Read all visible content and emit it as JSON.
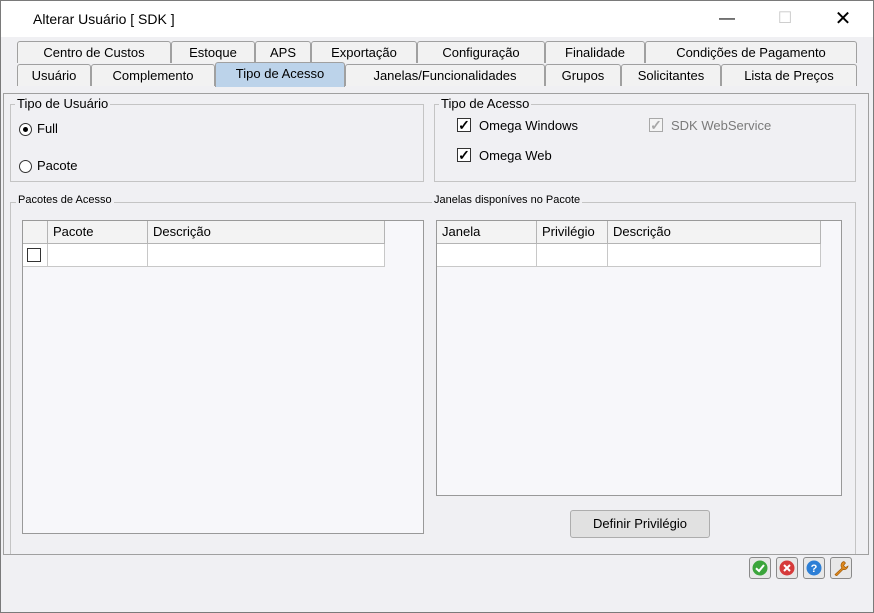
{
  "window": {
    "title": "Alterar Usuário [ SDK ]"
  },
  "tabs_row1": [
    "Centro de Custos",
    "Estoque",
    "APS",
    "Exportação",
    "Configuração",
    "Finalidade",
    "Condições de Pagamento"
  ],
  "tabs_row2": [
    "Usuário",
    "Complemento",
    "Tipo de Acesso",
    "Janelas/Funcionalidades",
    "Grupos",
    "Solicitantes",
    "Lista de Preços"
  ],
  "active_tab": "Tipo de Acesso",
  "tipo_usuario": {
    "title": "Tipo de Usuário",
    "options": [
      "Full",
      "Pacote"
    ],
    "selected": "Full"
  },
  "tipo_acesso": {
    "title": "Tipo de Acesso",
    "omega_windows": "Omega Windows",
    "omega_web": "Omega Web",
    "sdk_webservice": "SDK WebService"
  },
  "pacotes": {
    "title": "Pacotes de Acesso",
    "columns": [
      "",
      "Pacote",
      "Descrição"
    ]
  },
  "janelas": {
    "title": "Janelas disponíves no Pacote",
    "columns": [
      "Janela",
      "Privilégio",
      "Descrição"
    ]
  },
  "buttons": {
    "definir_privilegio": "Definir Privilégio"
  },
  "colors": {
    "active_tab": "#bcd3ea",
    "ok": "#3ba53b",
    "cancel": "#d63a3a",
    "help": "#2d7fd6",
    "tool": "#e08a1e"
  },
  "icons": [
    "check-icon",
    "close-icon",
    "help-icon",
    "wrench-icon"
  ]
}
